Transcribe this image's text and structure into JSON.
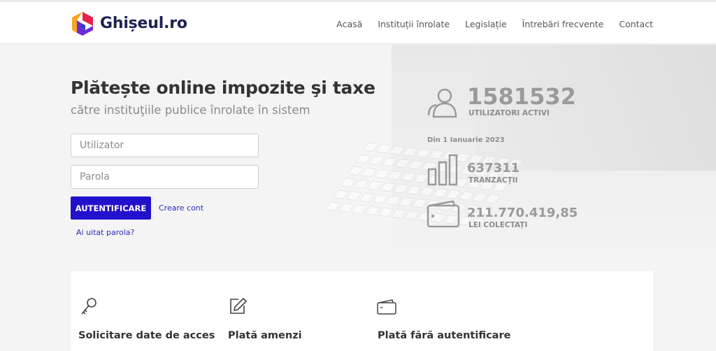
{
  "header": {
    "brand": "Ghișeul.ro",
    "nav": [
      "Acasă",
      "Instituții înrolate",
      "Legislație",
      "Întrebări frecvente",
      "Contact"
    ]
  },
  "hero": {
    "title": "Plătește online impozite şi taxe",
    "subtitle": "către instituţiile publice înrolate în sistem"
  },
  "login": {
    "user_placeholder": "Utilizator",
    "pass_placeholder": "Parola",
    "submit_label": "AUTENTIFICARE",
    "create_account": "Creare cont",
    "forgot_password": "Ai uitat parola?"
  },
  "stats": {
    "users_value": "1581532",
    "users_label": "UTILIZATORI ACTIVI",
    "since": "Din 1 Ianuarie 2023",
    "transactions_value": "637311",
    "transactions_label": "TRANZACȚII",
    "collected_value": "211.770.419,85",
    "collected_label": "LEI COLECTAȚI"
  },
  "cards": [
    {
      "title": "Solicitare date de acces",
      "icon": "key-icon"
    },
    {
      "title": "Plată amenzi",
      "icon": "edit-icon"
    },
    {
      "title": "Plată fără autentificare",
      "icon": "wallet-icon"
    }
  ],
  "colors": {
    "primary_button": "#2211cc",
    "link": "#2b2bbf",
    "brand_text": "#1e2252"
  }
}
